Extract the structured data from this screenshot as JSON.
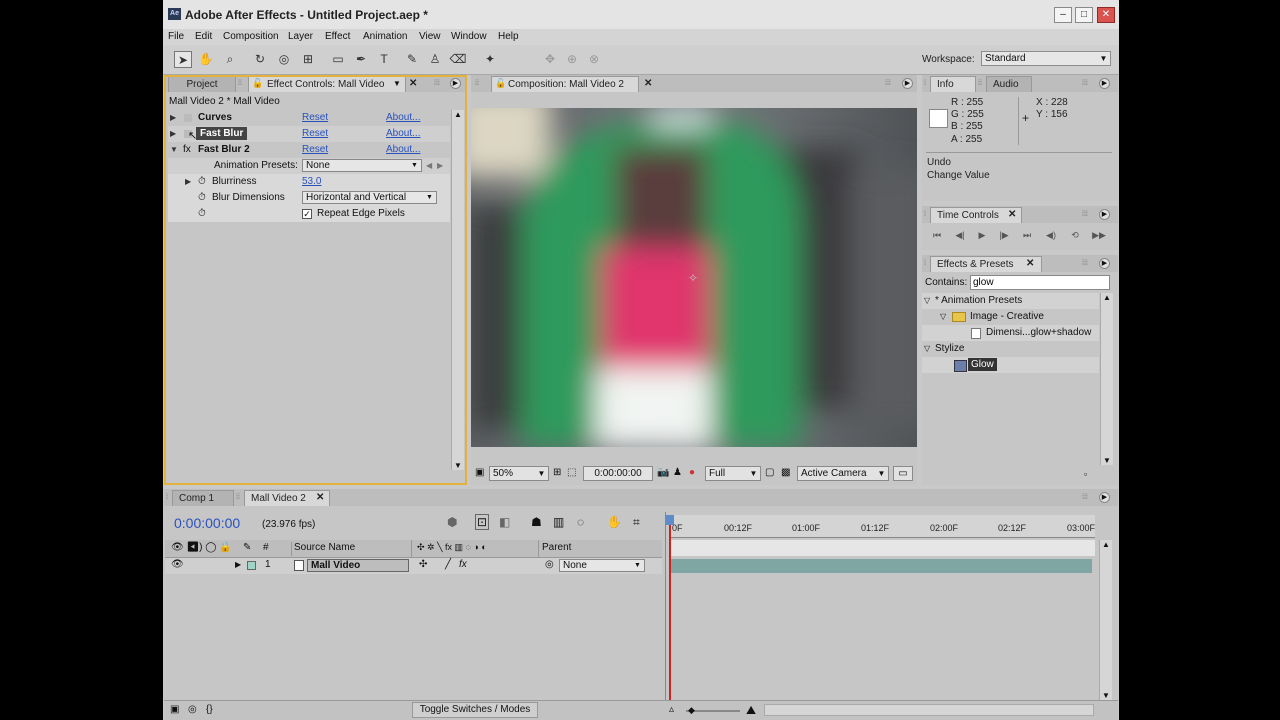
{
  "window": {
    "title": "Adobe After Effects - Untitled Project.aep *",
    "logo_text": "Ae"
  },
  "menu": [
    "File",
    "Edit",
    "Composition",
    "Layer",
    "Effect",
    "Animation",
    "View",
    "Window",
    "Help"
  ],
  "workspace": {
    "label": "Workspace:",
    "value": "Standard"
  },
  "left_panel": {
    "tabs": {
      "project": "Project",
      "effect_controls": "Effect Controls: Mall Video"
    },
    "breadcrumb": "Mall Video 2 * Mall Video",
    "effects": [
      {
        "name": "Curves",
        "reset": "Reset",
        "about": "About..."
      },
      {
        "name": "Fast Blur",
        "reset": "Reset",
        "about": "About..."
      },
      {
        "name": "Fast Blur 2",
        "reset": "Reset",
        "about": "About..."
      }
    ],
    "animation_presets": {
      "label": "Animation Presets:",
      "value": "None"
    },
    "blurriness": {
      "label": "Blurriness",
      "value": "53.0"
    },
    "blur_dimensions": {
      "label": "Blur Dimensions",
      "value": "Horizontal and Vertical"
    },
    "repeat_edge": {
      "label": "Repeat Edge Pixels",
      "checked": true
    }
  },
  "composition": {
    "tab": "Composition: Mall Video 2",
    "zoom": "50%",
    "timecode": "0:00:00:00",
    "resolution": "Full",
    "camera": "Active Camera"
  },
  "info": {
    "tabs": {
      "info": "Info",
      "audio": "Audio"
    },
    "r": "R : 255",
    "g": "G : 255",
    "b": "B : 255",
    "a": "A : 255",
    "x": "X : 228",
    "y": "Y : 156",
    "undo_label": "Undo",
    "undo_value": "Change Value"
  },
  "time_controls": {
    "tab": "Time Controls"
  },
  "effects_presets": {
    "tab": "Effects & Presets",
    "contains_label": "Contains:",
    "search_value": "glow",
    "tree": {
      "animation_presets": "* Animation Presets",
      "image_creative": "Image - Creative",
      "dimensi": "Dimensi...glow+shadow",
      "stylize": "Stylize",
      "glow": "Glow"
    }
  },
  "timeline": {
    "tabs": {
      "comp1": "Comp 1",
      "mall2": "Mall Video 2"
    },
    "timecode": "0:00:00:00",
    "fps": "(23.976 fps)",
    "col_source": "Source Name",
    "col_parent": "Parent",
    "layer": {
      "num": "1",
      "name": "Mall Video",
      "parent": "None"
    },
    "ruler": [
      "0F",
      "00:12F",
      "01:00F",
      "01:12F",
      "02:00F",
      "02:12F",
      "03:00F"
    ],
    "toggle_label": "Toggle Switches / Modes"
  },
  "colors": {
    "accent_outline": "#e3b23c",
    "link": "#2a52be",
    "playhead": "#cc2222"
  }
}
